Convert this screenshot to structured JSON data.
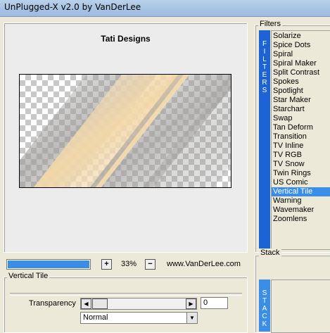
{
  "window": {
    "title": "UnPlugged-X v2.0 by VanDerLee"
  },
  "preview": {
    "title": "Tati Designs"
  },
  "toolbar": {
    "zoom_in_label": "+",
    "zoom_out_label": "−",
    "zoom_level": "33%",
    "website": "www.VanDerLee.com",
    "progress_fraction": 1.0
  },
  "settings": {
    "group_label": "Vertical Tile",
    "transparency_label": "Transparency",
    "transparency_value": "0",
    "blend_mode": "Normal"
  },
  "filters": {
    "label": "Filters",
    "strip_letters": [
      "F",
      "I",
      "L",
      "T",
      "E",
      "R",
      "S"
    ],
    "items": [
      "Solarize",
      "Spice Dots",
      "Spiral",
      "Spiral Maker",
      "Split Contrast",
      "Spokes",
      "Spotlight",
      "Star Maker",
      "Starchart",
      "Swap",
      "Tan Deform",
      "Transition",
      "TV Inline",
      "TV RGB",
      "TV Snow",
      "Twin Rings",
      "US Comic",
      "Vertical Tile",
      "Warning",
      "Wavemaker",
      "Zoomlens"
    ],
    "selected": "Vertical Tile"
  },
  "stack": {
    "label": "Stack",
    "strip_letters": [
      "S",
      "T",
      "A",
      "C",
      "K"
    ]
  },
  "colors": {
    "accent": "#3b8ee8",
    "filter_strip": "#1c64d6"
  }
}
